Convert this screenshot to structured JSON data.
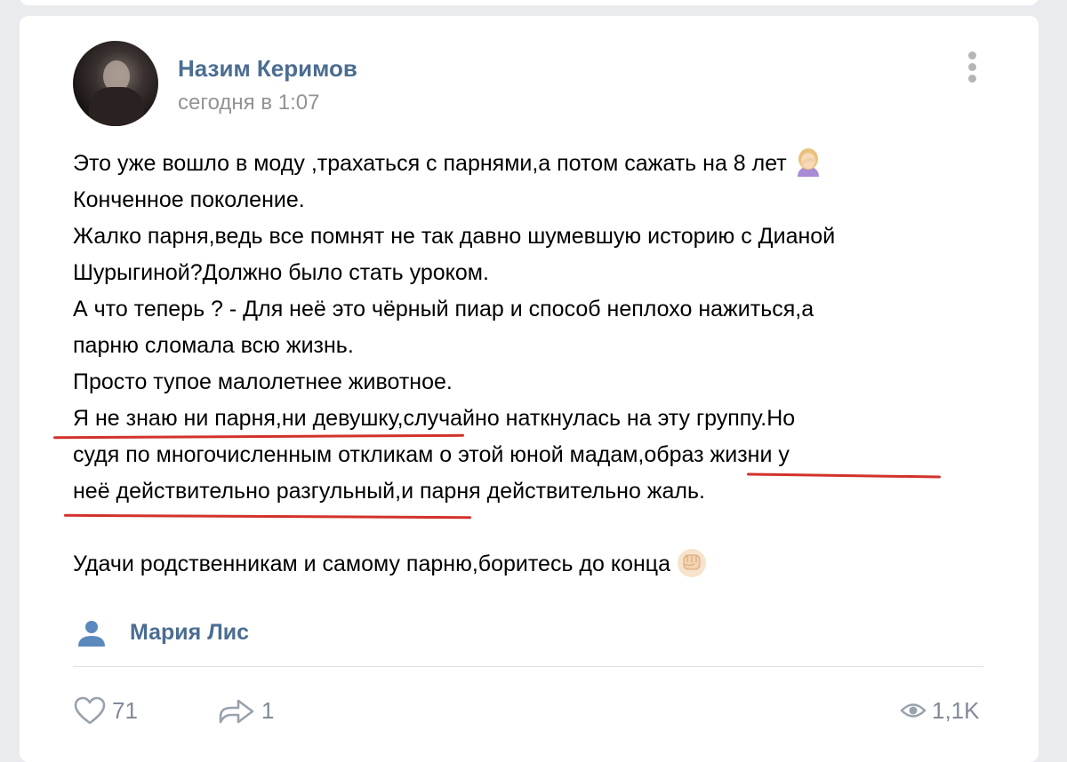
{
  "post": {
    "author": "Назим Керимов",
    "time": "сегодня в 1:07",
    "lines": [
      "Это уже вошло в моду ,трахаться с парнями,а потом сажать на 8 лет",
      "Конченное поколение.",
      "Жалко парня,ведь все помнят не так давно шумевшую историю с Дианой",
      "Шурыгиной?Должно было стать уроком.",
      "А что теперь ? - Для неё это чёрный пиар и способ неплохо нажиться,а",
      "парню сломала всю жизнь.",
      "Просто тупое малолетнее животное.",
      "Я не знаю ни парня,ни девушку,случайно наткнулась на эту группу.Но",
      "судя по многочисленным откликам о этой юной мадам,образ жизни у",
      "неё действительно разгульный,и парня действительно жаль.",
      "",
      "Удачи родственникам и самому парню,боритесь до конца"
    ],
    "signer": "Мария Лис"
  },
  "footer": {
    "likes": "71",
    "shares": "1",
    "views": "1,1K"
  },
  "icons": {
    "facepalm": "facepalm-emoji",
    "fist": "raised-fist-emoji",
    "like": "heart-icon",
    "share": "share-arrow-icon",
    "views": "eye-icon",
    "signer": "user-icon",
    "menu": "more-vertical-icon"
  },
  "colors": {
    "link": "#4b6d92",
    "meta": "#939393",
    "footer": "#828a99",
    "underline": "#d3322b",
    "background": "#e9ebee"
  }
}
